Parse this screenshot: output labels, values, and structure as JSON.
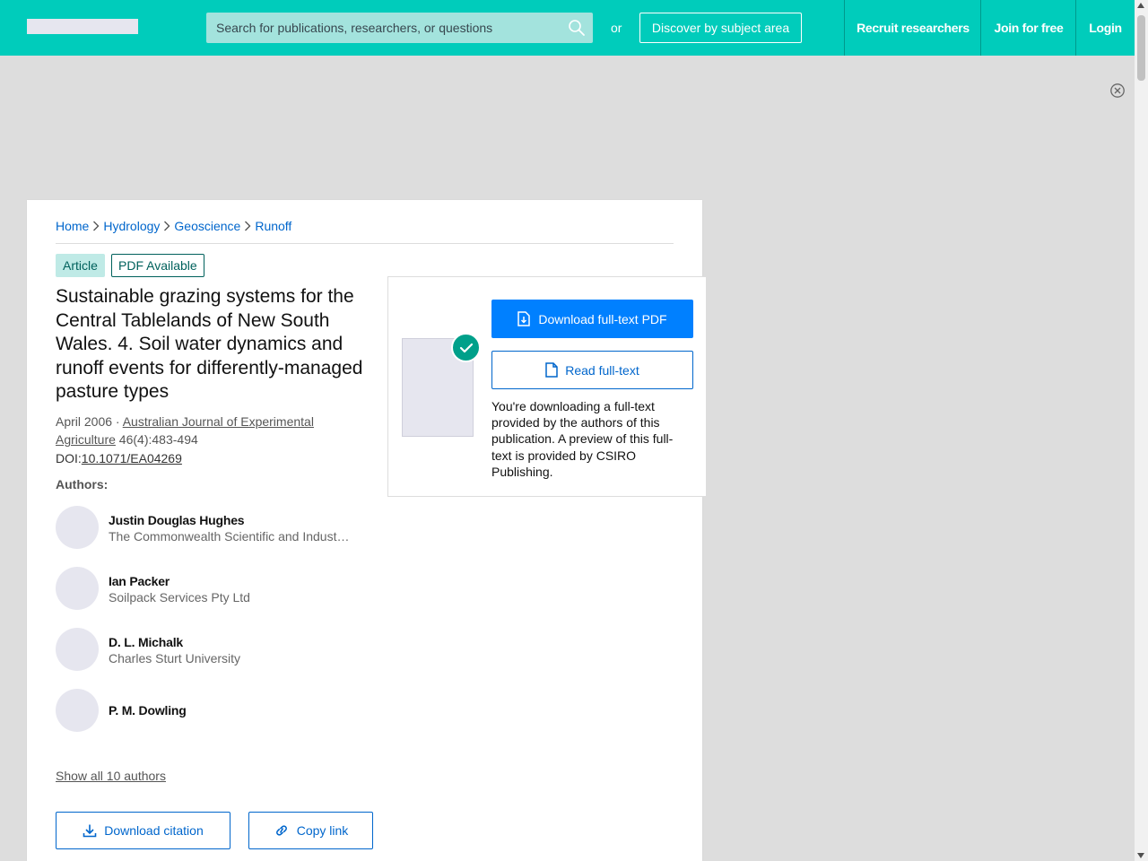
{
  "header": {
    "search_placeholder": "Search for publications, researchers, or questions",
    "or_text": "or",
    "discover_label": "Discover by subject area",
    "nav": {
      "recruit": "Recruit researchers",
      "join": "Join for free",
      "login": "Login"
    }
  },
  "breadcrumb": [
    "Home",
    "Hydrology",
    "Geoscience",
    "Runoff"
  ],
  "badges": {
    "type": "Article",
    "pdf": "PDF Available"
  },
  "article": {
    "title": "Sustainable grazing systems for the Central Tablelands of New South Wales. 4. Soil water dynamics and runoff events for differently-managed pasture types",
    "date": "April 2006",
    "date_sep": " · ",
    "journal": "Australian Journal of Experimental Agriculture",
    "volume": " 46(4):483-494",
    "doi_label": "DOI:",
    "doi": "10.1071/EA04269",
    "authors_label": "Authors:",
    "authors": [
      {
        "name": "Justin Douglas Hughes",
        "institution": "The Commonwealth Scientific and Industrial Research Organisation"
      },
      {
        "name": "Ian Packer",
        "institution": "Soilpack Services Pty Ltd"
      },
      {
        "name": "D. L. Michalk",
        "institution": "Charles Sturt University"
      },
      {
        "name": "P. M. Dowling",
        "institution": ""
      }
    ],
    "show_all": "Show all 10 authors",
    "download_citation": "Download citation",
    "copy_link": "Copy link"
  },
  "download": {
    "download_pdf": "Download full-text PDF",
    "read_fulltext": "Read full-text",
    "note": "You're downloading a full-text provided by the authors of this publication. A preview of this full-text is provided by CSIRO Publishing."
  },
  "colors": {
    "brand": "#00ccbb",
    "primary": "#0080ff",
    "link": "#0066cc"
  }
}
